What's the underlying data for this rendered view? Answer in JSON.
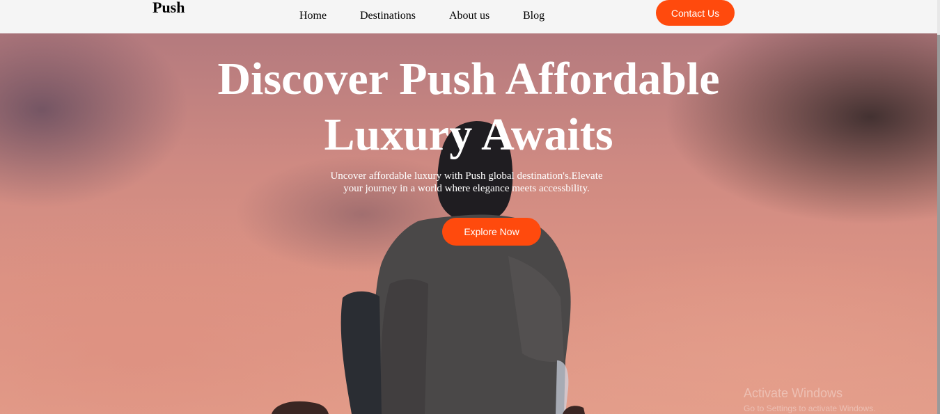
{
  "brand": "Push",
  "nav": {
    "items": [
      {
        "label": "Home"
      },
      {
        "label": "Destinations"
      },
      {
        "label": "About us"
      },
      {
        "label": "Blog"
      }
    ],
    "contact_label": "Contact Us"
  },
  "hero": {
    "title_line1": "Discover Push Affordable",
    "title_line2": "Luxury Awaits",
    "subtitle_line1": "Uncover affordable luxury with Push global destination's.Elevate",
    "subtitle_line2": "your journey in a world where elegance meets accessbility.",
    "cta_label": "Explore Now"
  },
  "watermark": {
    "title": "Activate Windows",
    "subtitle": "Go to Settings to activate Windows."
  },
  "colors": {
    "accent": "#ff4a0d",
    "nav_bg": "#f5f5f5",
    "hero_text": "#ffffff"
  }
}
